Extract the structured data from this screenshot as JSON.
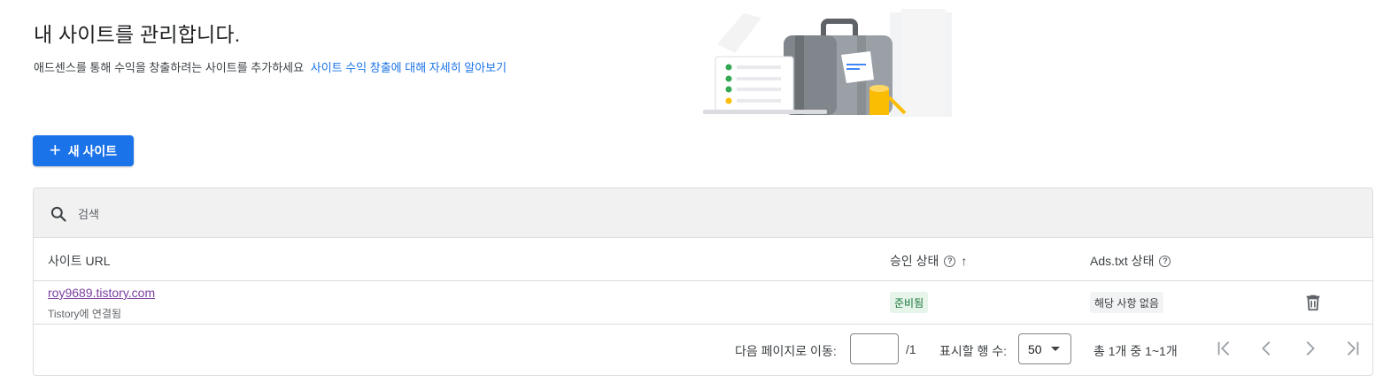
{
  "header": {
    "title": "내 사이트를 관리합니다.",
    "subtitle": "애드센스를 통해 수익을 창출하려는 사이트를 추가하세요",
    "learn_more_link": "사이트 수익 창출에 대해 자세히 알아보기"
  },
  "actions": {
    "new_site_plus": "+",
    "new_site_label": "새 사이트"
  },
  "search": {
    "placeholder": "검색"
  },
  "table": {
    "columns": {
      "site_url": "사이트 URL",
      "approval_status": "승인 상태",
      "ads_txt_status": "Ads.txt 상태"
    },
    "help_glyph": "?",
    "sort_glyph": "↑",
    "rows": [
      {
        "url": "roy9689.tistory.com",
        "connection": "Tistory에 연결됨",
        "approval": "준비됨",
        "ads_txt": "해당 사항 없음"
      }
    ]
  },
  "pagination": {
    "goto_label": "다음 페이지로 이동:",
    "page_value": "",
    "total_pages": "/1",
    "rows_label": "표시할 행 수:",
    "rows_value": "50",
    "range_text": "총 1개 중 1~1개"
  },
  "colors": {
    "primary": "#1a73e8",
    "approved_bg": "#e6f4ea",
    "approved_text": "#137333",
    "visited_link": "#7b3fa0"
  },
  "icons": [
    "plus-icon",
    "search-icon",
    "help-icon",
    "sort-up-icon",
    "trash-icon",
    "first-page-icon",
    "prev-page-icon",
    "next-page-icon",
    "last-page-icon",
    "caret-down-icon"
  ]
}
